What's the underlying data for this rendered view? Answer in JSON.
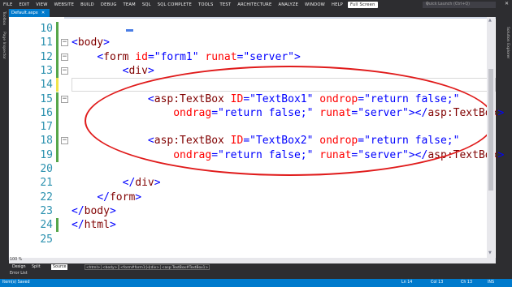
{
  "menubar": {
    "items": [
      "FILE",
      "EDIT",
      "VIEW",
      "WEBSITE",
      "BUILD",
      "DEBUG",
      "TEAM",
      "SQL",
      "SQL COMPLETE",
      "TOOLS",
      "TEST",
      "ARCHITECTURE",
      "ANALYZE",
      "WINDOW",
      "HELP"
    ],
    "fullscreen_label": "Full Screen",
    "quicklaunch_placeholder": "Quick Launch (Ctrl+Q)",
    "search_icon": "search-icon",
    "close_icon": "close-icon"
  },
  "tabs": {
    "active": "Default.aspx"
  },
  "side_panels": {
    "left": [
      "Toolbox",
      "Page Inspector"
    ],
    "right": [
      "Solution Explorer"
    ]
  },
  "editor": {
    "lines": [
      {
        "n": "10",
        "change": "green",
        "code": ""
      },
      {
        "n": "11",
        "change": "green",
        "fold": "−",
        "segs": [
          [
            "p",
            "<"
          ],
          [
            "t",
            "body"
          ],
          [
            "p",
            ">"
          ]
        ]
      },
      {
        "n": "12",
        "change": "green",
        "fold": "−",
        "segs": [
          [
            "x",
            "    "
          ],
          [
            "p",
            "<"
          ],
          [
            "t",
            "form"
          ],
          [
            "x",
            " "
          ],
          [
            "a",
            "id"
          ],
          [
            "p",
            "="
          ],
          [
            "v",
            "\"form1\""
          ],
          [
            "x",
            " "
          ],
          [
            "a",
            "runat"
          ],
          [
            "p",
            "="
          ],
          [
            "v",
            "\"server\""
          ],
          [
            "p",
            ">"
          ]
        ]
      },
      {
        "n": "13",
        "change": "green",
        "fold": "−",
        "segs": [
          [
            "x",
            "        "
          ],
          [
            "p",
            "<"
          ],
          [
            "t",
            "div"
          ],
          [
            "p",
            ">"
          ]
        ]
      },
      {
        "n": "14",
        "change": "yellow",
        "current": true,
        "segs": []
      },
      {
        "n": "15",
        "change": "green",
        "fold": "−",
        "segs": [
          [
            "x",
            "            "
          ],
          [
            "p",
            "<"
          ],
          [
            "t",
            "asp:TextBox"
          ],
          [
            "x",
            " "
          ],
          [
            "a",
            "ID"
          ],
          [
            "p",
            "="
          ],
          [
            "v",
            "\"TextBox1\""
          ],
          [
            "x",
            " "
          ],
          [
            "a",
            "ondrop"
          ],
          [
            "p",
            "="
          ],
          [
            "v",
            "\"return false;\""
          ]
        ]
      },
      {
        "n": "16",
        "change": "green",
        "segs": [
          [
            "x",
            "                "
          ],
          [
            "a",
            "ondrag"
          ],
          [
            "p",
            "="
          ],
          [
            "v",
            "\"return false;\""
          ],
          [
            "x",
            " "
          ],
          [
            "a",
            "runat"
          ],
          [
            "p",
            "="
          ],
          [
            "v",
            "\"server\""
          ],
          [
            "p",
            "></"
          ],
          [
            "t",
            "asp:TextBox"
          ],
          [
            "p",
            ">"
          ]
        ]
      },
      {
        "n": "17",
        "change": "green",
        "segs": []
      },
      {
        "n": "18",
        "change": "green",
        "fold": "−",
        "segs": [
          [
            "x",
            "            "
          ],
          [
            "p",
            "<"
          ],
          [
            "t",
            "asp:TextBox"
          ],
          [
            "x",
            " "
          ],
          [
            "a",
            "ID"
          ],
          [
            "p",
            "="
          ],
          [
            "v",
            "\"TextBox2\""
          ],
          [
            "x",
            " "
          ],
          [
            "a",
            "ondrop"
          ],
          [
            "p",
            "="
          ],
          [
            "v",
            "\"return false;\""
          ]
        ]
      },
      {
        "n": "19",
        "change": "green",
        "segs": [
          [
            "x",
            "                "
          ],
          [
            "a",
            "ondrag"
          ],
          [
            "p",
            "="
          ],
          [
            "v",
            "\"return false;\""
          ],
          [
            "x",
            " "
          ],
          [
            "a",
            "runat"
          ],
          [
            "p",
            "="
          ],
          [
            "v",
            "\"server\""
          ],
          [
            "p",
            "></"
          ],
          [
            "t",
            "asp:TextBox"
          ],
          [
            "p",
            ">"
          ]
        ]
      },
      {
        "n": "20",
        "change": "",
        "segs": []
      },
      {
        "n": "21",
        "change": "",
        "segs": [
          [
            "x",
            "        "
          ],
          [
            "p",
            "</"
          ],
          [
            "t",
            "div"
          ],
          [
            "p",
            ">"
          ]
        ]
      },
      {
        "n": "22",
        "change": "",
        "segs": [
          [
            "x",
            "    "
          ],
          [
            "p",
            "</"
          ],
          [
            "t",
            "form"
          ],
          [
            "p",
            ">"
          ]
        ]
      },
      {
        "n": "23",
        "change": "",
        "segs": [
          [
            "p",
            "</"
          ],
          [
            "t",
            "body"
          ],
          [
            "p",
            ">"
          ]
        ]
      },
      {
        "n": "24",
        "change": "green",
        "segs": [
          [
            "p",
            "</"
          ],
          [
            "t",
            "html"
          ],
          [
            "p",
            ">"
          ]
        ]
      },
      {
        "n": "25",
        "change": "",
        "segs": []
      }
    ]
  },
  "zoom": "100 %",
  "view_buttons": [
    "Design",
    "Split",
    "Source"
  ],
  "breadcrumbs": [
    "<html>",
    "<body>",
    "<form#form1>",
    "<div>",
    "<asp:TextBox#TextBox1>"
  ],
  "error_list": "Error List",
  "status": {
    "left": "Item(s) Saved",
    "ln": "Ln 14",
    "col": "Col 13",
    "ch": "Ch 13",
    "mode": "INS"
  },
  "colors": {
    "accent": "#007acc",
    "tag": "#800000",
    "attr": "#ff0000",
    "value": "#0000ff",
    "annotation": "#e01b1b"
  }
}
